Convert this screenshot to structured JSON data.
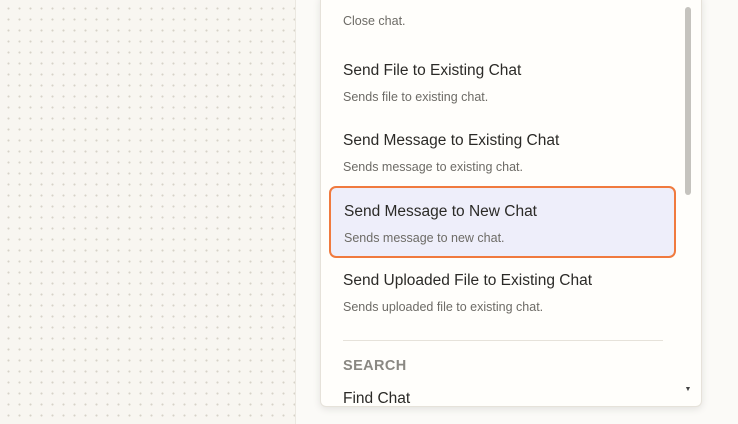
{
  "dropdown": {
    "options": [
      {
        "title": "",
        "desc": "Close chat."
      },
      {
        "title": "Send File to Existing Chat",
        "desc": "Sends file to existing chat."
      },
      {
        "title": "Send Message to Existing Chat",
        "desc": "Sends message to existing chat."
      },
      {
        "title": "Send Message to New Chat",
        "desc": "Sends message to new chat."
      },
      {
        "title": "Send Uploaded File to Existing Chat",
        "desc": "Sends uploaded file to existing chat."
      }
    ],
    "search_section": {
      "header": "SEARCH",
      "first_item": "Find Chat"
    }
  },
  "colors": {
    "selected_border": "#f07a3e",
    "selected_bg": "#eeeefa"
  },
  "icons": {
    "scroll_down": "▼"
  }
}
